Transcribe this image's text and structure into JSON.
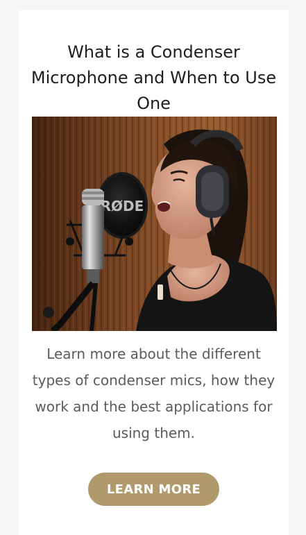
{
  "article": {
    "title": "What is a Condenser Microphone and When to Use One",
    "description": "Learn more about the different types of condenser mics, how they work and the best applications for using them.",
    "cta_label": "LEARN MORE",
    "image": {
      "mic_brand_text": "RØDE"
    }
  },
  "colors": {
    "page_background": "#f5f6f8",
    "card_background": "#ffffff",
    "title_text": "#1e1e22",
    "body_text": "#5a5a5f",
    "cta_background": "#b09a6c",
    "cta_text": "#ffffff"
  }
}
